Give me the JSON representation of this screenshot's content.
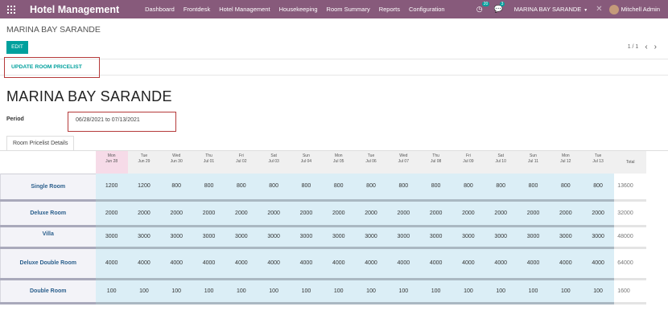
{
  "navbar": {
    "brand": "Hotel Management",
    "menu": [
      "Dashboard",
      "Frontdesk",
      "Hotel Management",
      "Housekeeping",
      "Room Summary",
      "Reports",
      "Configuration"
    ],
    "activity_count": "20",
    "message_count": "3",
    "company": "MARINA BAY SARANDE",
    "user": "Mitchell Admin"
  },
  "control": {
    "breadcrumb": "MARINA BAY SARANDE",
    "edit_label": "EDIT",
    "pager": "1 / 1"
  },
  "actions": {
    "update_label": "UPDATE ROOM PRICELIST"
  },
  "form": {
    "title": "MARINA BAY SARANDE",
    "period_label": "Period",
    "period_value": "06/28/2021 to 07/13/2021",
    "tab_label": "Room Pricelist Details"
  },
  "table": {
    "columns": [
      {
        "day": "Mon",
        "date": "Jun 28"
      },
      {
        "day": "Tue",
        "date": "Jun 29"
      },
      {
        "day": "Wed",
        "date": "Jun 30"
      },
      {
        "day": "Thu",
        "date": "Jul 01"
      },
      {
        "day": "Fri",
        "date": "Jul 02"
      },
      {
        "day": "Sat",
        "date": "Jul 03"
      },
      {
        "day": "Sun",
        "date": "Jul 04"
      },
      {
        "day": "Mon",
        "date": "Jul 05"
      },
      {
        "day": "Tue",
        "date": "Jul 06"
      },
      {
        "day": "Wed",
        "date": "Jul 07"
      },
      {
        "day": "Thu",
        "date": "Jul 08"
      },
      {
        "day": "Fri",
        "date": "Jul 09"
      },
      {
        "day": "Sat",
        "date": "Jul 10"
      },
      {
        "day": "Sun",
        "date": "Jul 11"
      },
      {
        "day": "Mon",
        "date": "Jul 12"
      },
      {
        "day": "Tue",
        "date": "Jul 13"
      }
    ],
    "total_label": "Total",
    "rows": [
      {
        "room": "Single Room",
        "prices": [
          "1200",
          "1200",
          "800",
          "800",
          "800",
          "800",
          "800",
          "800",
          "800",
          "800",
          "800",
          "800",
          "800",
          "800",
          "800",
          "800"
        ],
        "total": "13600"
      },
      {
        "room": "Deluxe Room",
        "prices": [
          "2000",
          "2000",
          "2000",
          "2000",
          "2000",
          "2000",
          "2000",
          "2000",
          "2000",
          "2000",
          "2000",
          "2000",
          "2000",
          "2000",
          "2000",
          "2000"
        ],
        "total": "32000"
      },
      {
        "room": "Villa",
        "prices": [
          "3000",
          "3000",
          "3000",
          "3000",
          "3000",
          "3000",
          "3000",
          "3000",
          "3000",
          "3000",
          "3000",
          "3000",
          "3000",
          "3000",
          "3000",
          "3000"
        ],
        "total": "48000"
      },
      {
        "room": "Deluxe Double Room",
        "prices": [
          "4000",
          "4000",
          "4000",
          "4000",
          "4000",
          "4000",
          "4000",
          "4000",
          "4000",
          "4000",
          "4000",
          "4000",
          "4000",
          "4000",
          "4000",
          "4000"
        ],
        "total": "64000"
      },
      {
        "room": "Double Room",
        "prices": [
          "100",
          "100",
          "100",
          "100",
          "100",
          "100",
          "100",
          "100",
          "100",
          "100",
          "100",
          "100",
          "100",
          "100",
          "100",
          "100"
        ],
        "total": "1600"
      }
    ]
  },
  "colors": {
    "navbar": "#875a7b",
    "primary": "#00a09d",
    "highlight_box": "#b53a3a",
    "price_cell": "#dbeef6",
    "today_header": "#f6dbe8"
  }
}
